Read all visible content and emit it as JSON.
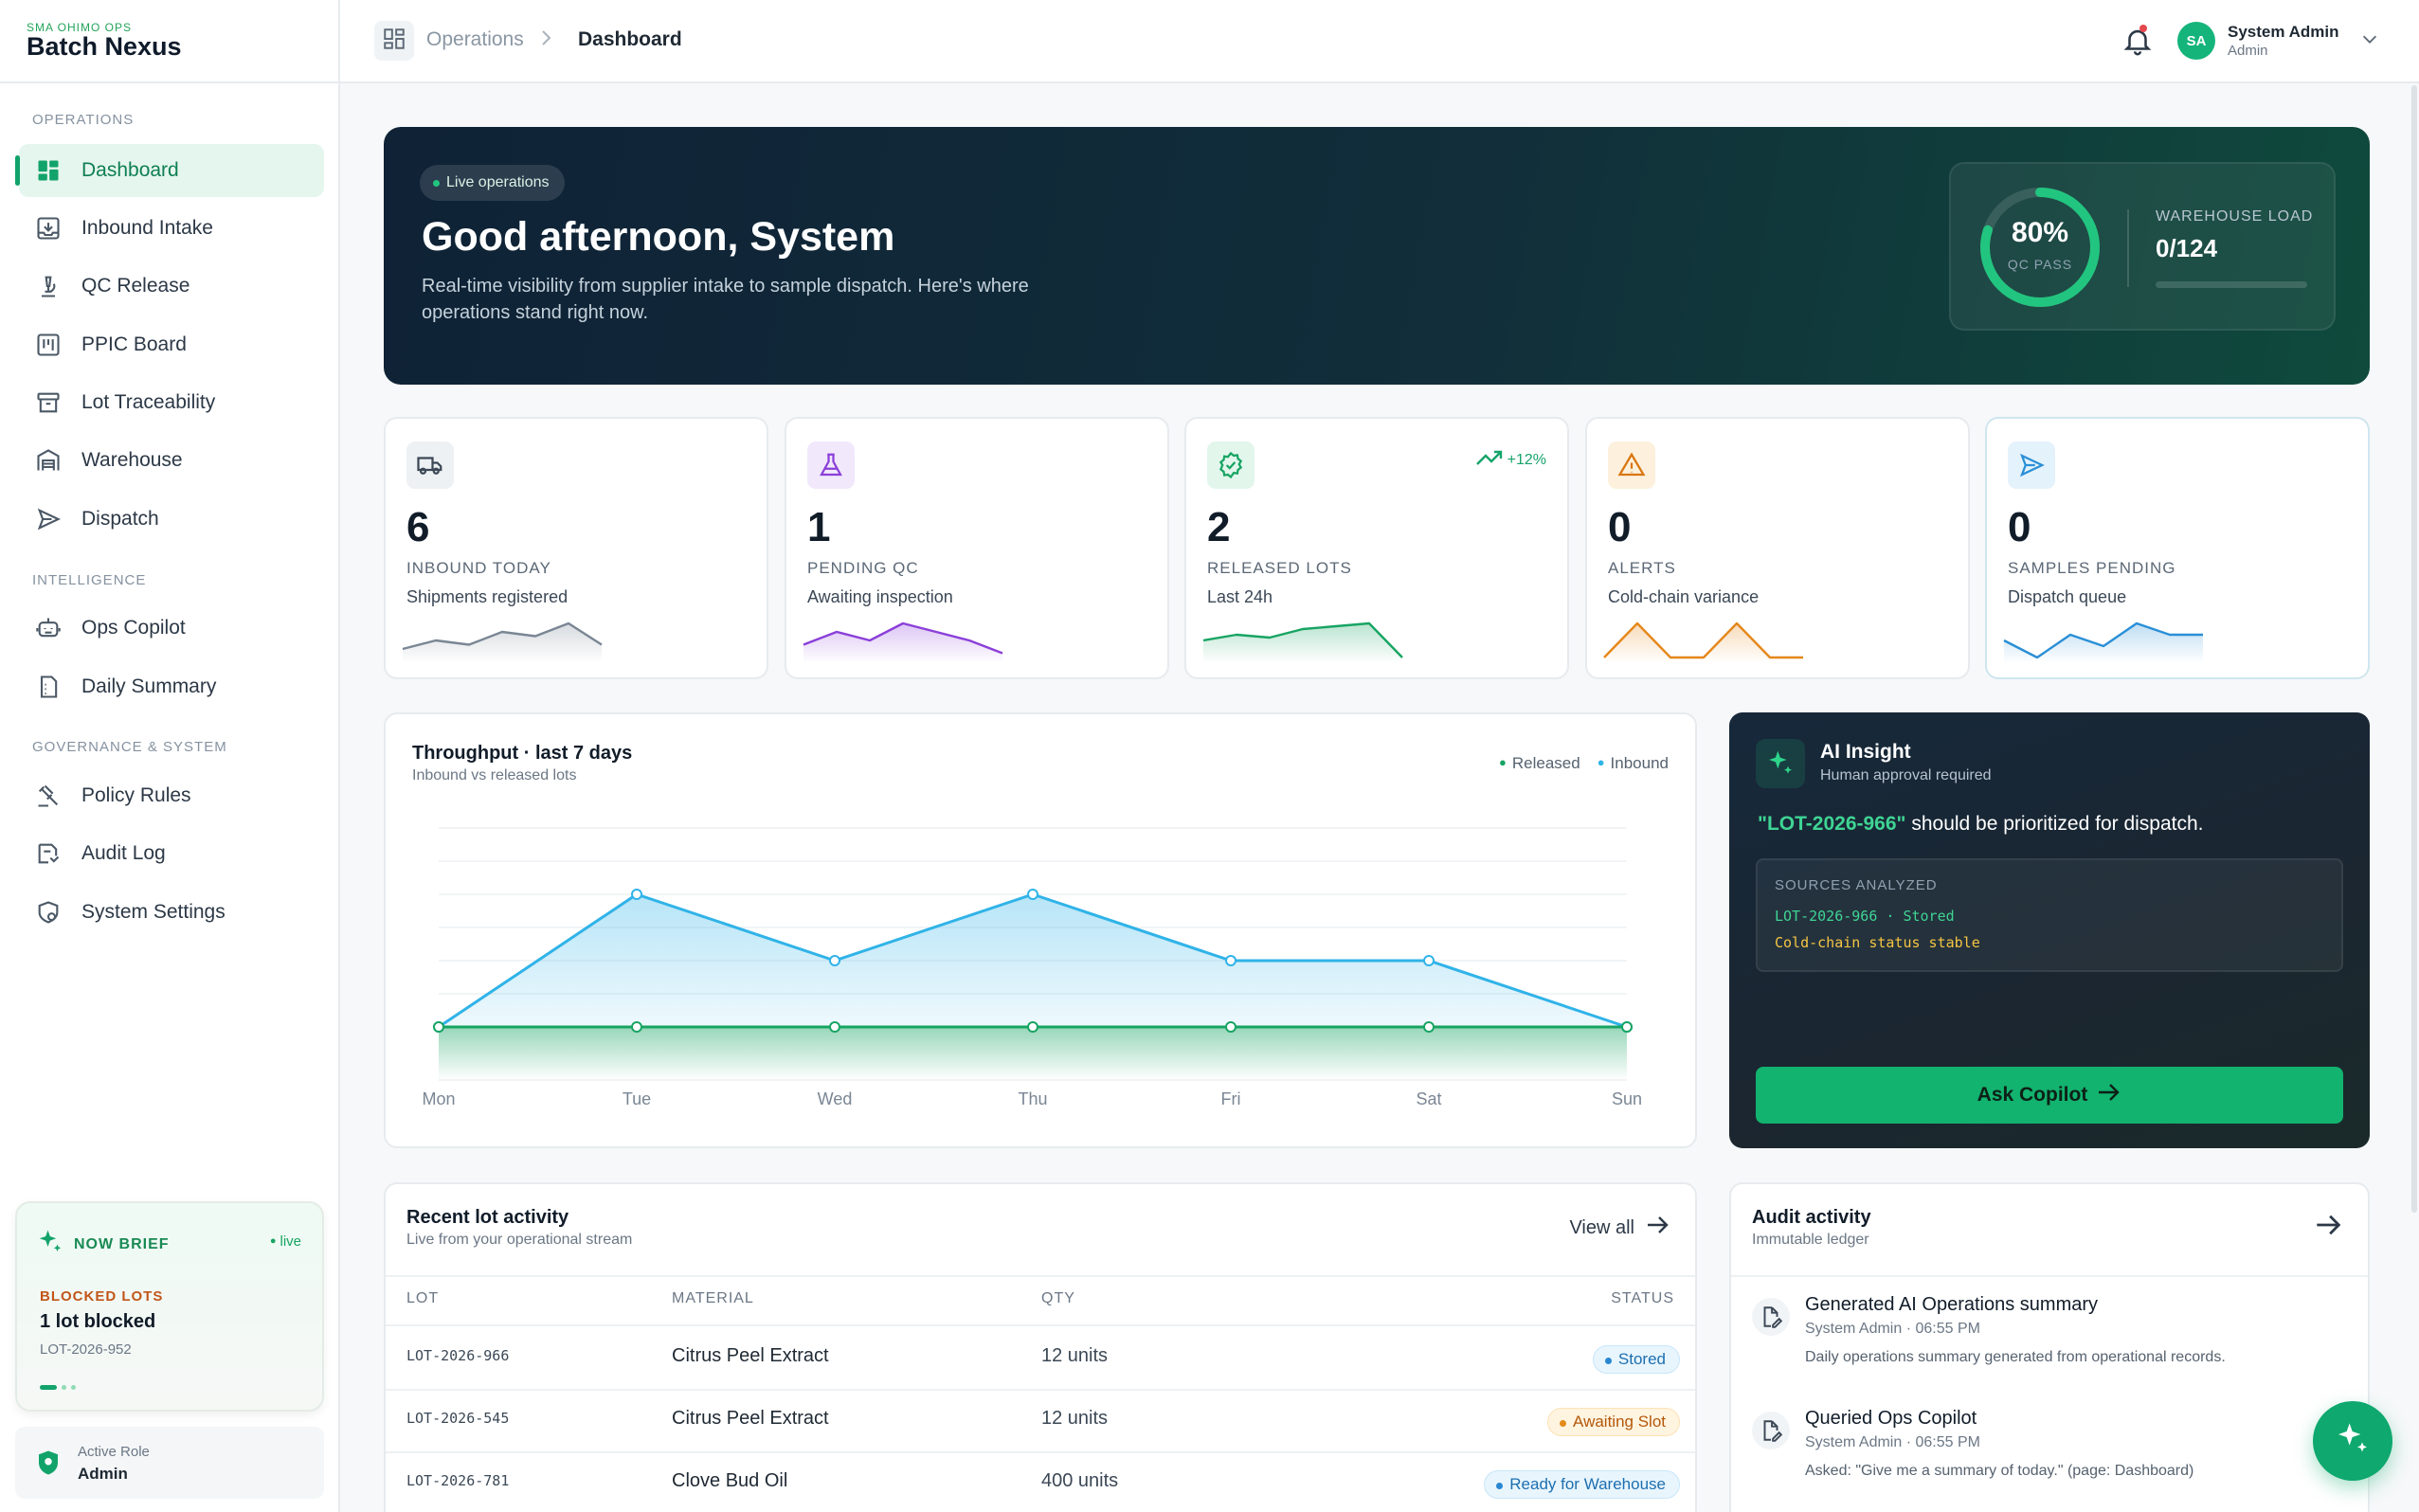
{
  "brand": {
    "sub": "SMA OHIMO OPS",
    "name": "Batch Nexus"
  },
  "sidebar": {
    "sections": [
      "OPERATIONS",
      "INTELLIGENCE",
      "GOVERNANCE & SYSTEM"
    ],
    "items": [
      {
        "label": "Dashboard",
        "icon": "dashboard-icon",
        "active": true
      },
      {
        "label": "Inbound Intake",
        "icon": "inbox-download-icon"
      },
      {
        "label": "QC Release",
        "icon": "microscope-icon"
      },
      {
        "label": "PPIC Board",
        "icon": "kanban-board-icon"
      },
      {
        "label": "Lot Traceability",
        "icon": "archive-box-icon"
      },
      {
        "label": "Warehouse",
        "icon": "warehouse-icon"
      },
      {
        "label": "Dispatch",
        "icon": "send-icon"
      },
      {
        "label": "Ops Copilot",
        "icon": "robot-icon"
      },
      {
        "label": "Daily Summary",
        "icon": "document-icon"
      },
      {
        "label": "Policy Rules",
        "icon": "gavel-icon"
      },
      {
        "label": "Audit Log",
        "icon": "audit-icon"
      },
      {
        "label": "System Settings",
        "icon": "settings-shield-icon"
      }
    ],
    "brief": {
      "title": "NOW BRIEF",
      "live": "live",
      "key": "BLOCKED LOTS",
      "value": "1 lot blocked",
      "lot": "LOT-2026-952"
    },
    "role": {
      "label": "Active Role",
      "value": "Admin"
    }
  },
  "topbar": {
    "breadcrumb": [
      "Operations",
      "Dashboard"
    ],
    "user": {
      "initials": "SA",
      "name": "System Admin",
      "role": "Admin"
    }
  },
  "hero": {
    "pill": "Live operations",
    "title": "Good afternoon, System",
    "subtitle": "Real-time visibility from supplier intake to sample dispatch. Here's where operations stand right now.",
    "qc_value": "80%",
    "qc_label": "QC PASS",
    "qc_fraction": 0.8,
    "warehouse_label": "WAREHOUSE LOAD",
    "warehouse_value": "0/124",
    "warehouse_fraction": 0
  },
  "kpis": [
    {
      "value": "6",
      "label": "INBOUND TODAY",
      "sub": "Shipments registered",
      "icon": "truck-icon",
      "color": "#7a8694",
      "bg": "#eef1f4",
      "trend": "",
      "spark": [
        2,
        4,
        3,
        6,
        5,
        8,
        3
      ]
    },
    {
      "value": "1",
      "label": "PENDING QC",
      "sub": "Awaiting inspection",
      "icon": "flask-icon",
      "color": "#8b3fd9",
      "bg": "#f1e8fc",
      "trend": "",
      "spark": [
        3,
        6,
        4,
        8,
        6,
        4,
        1
      ]
    },
    {
      "value": "2",
      "label": "RELEASED LOTS",
      "sub": "Last 24h",
      "icon": "badge-check-icon",
      "color": "#18a463",
      "bg": "#e2f6ec",
      "trend": "+12%",
      "spark": [
        3,
        4,
        3.5,
        5,
        5.5,
        6,
        0
      ]
    },
    {
      "value": "0",
      "label": "ALERTS",
      "sub": "Cold-chain variance",
      "icon": "warning-icon",
      "color": "#e5871a",
      "bg": "#fdf1dd",
      "trend": "",
      "spark": [
        0,
        6,
        0,
        0,
        6,
        0,
        0
      ]
    },
    {
      "value": "0",
      "label": "SAMPLES PENDING",
      "sub": "Dispatch queue",
      "icon": "send-icon",
      "color": "#2a8fd6",
      "bg": "#e4f2fc",
      "trend": "",
      "spark": [
        3,
        0,
        4,
        2,
        6,
        4,
        4
      ]
    }
  ],
  "throughput": {
    "title": "Throughput · last 7 days",
    "subtitle": "Inbound vs released lots",
    "legend": [
      "Released",
      "Inbound"
    ]
  },
  "chart_data": {
    "type": "area",
    "title": "Throughput · last 7 days",
    "subtitle": "Inbound vs released lots",
    "x": [
      "Mon",
      "Tue",
      "Wed",
      "Thu",
      "Fri",
      "Sat",
      "Sun"
    ],
    "ylim": [
      0,
      3
    ],
    "grid": true,
    "legend_position": "top-right",
    "series": [
      {
        "name": "Inbound",
        "color": "#30b3e8",
        "values": [
          0,
          2,
          1,
          2,
          1,
          1,
          0
        ]
      },
      {
        "name": "Released",
        "color": "#18a463",
        "values": [
          0,
          0,
          0,
          0,
          0,
          0,
          0
        ]
      }
    ]
  },
  "ai": {
    "title": "AI Insight",
    "subtitle": "Human approval required",
    "lot": "\"LOT-2026-966\"",
    "message": " should be prioritized for dispatch.",
    "sources_label": "SOURCES ANALYZED",
    "source1": "LOT-2026-966 · Stored",
    "source2": "Cold-chain status stable",
    "button": "Ask Copilot"
  },
  "recent": {
    "title": "Recent lot activity",
    "subtitle": "Live from your operational stream",
    "view_all": "View all",
    "columns": [
      "LOT",
      "MATERIAL",
      "QTY",
      "STATUS"
    ],
    "rows": [
      {
        "lot": "LOT-2026-966",
        "material": "Citrus Peel Extract",
        "qty": "12 units",
        "status": "Stored",
        "kind": "stored"
      },
      {
        "lot": "LOT-2026-545",
        "material": "Citrus Peel Extract",
        "qty": "12 units",
        "status": "Awaiting Slot",
        "kind": "await"
      },
      {
        "lot": "LOT-2026-781",
        "material": "Clove Bud Oil",
        "qty": "400 units",
        "status": "Ready for Warehouse",
        "kind": "ready"
      }
    ]
  },
  "audit": {
    "title": "Audit activity",
    "subtitle": "Immutable ledger",
    "items": [
      {
        "title": "Generated AI Operations summary",
        "meta": "System Admin · 06:55 PM",
        "desc": "Daily operations summary generated from operational records."
      },
      {
        "title": "Queried Ops Copilot",
        "meta": "System Admin · 06:55 PM",
        "desc": "Asked: \"Give me a summary of today.\" (page: Dashboard)"
      }
    ]
  }
}
